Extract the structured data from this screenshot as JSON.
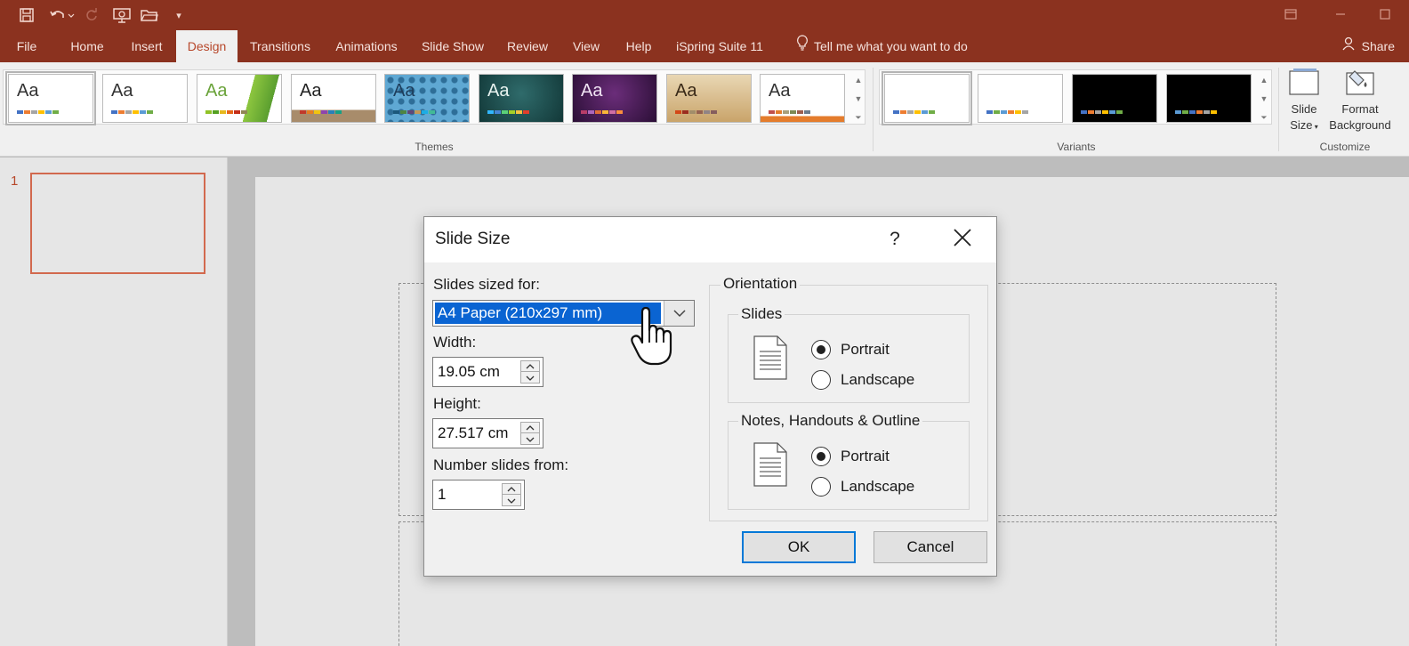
{
  "ribbon_tabs": [
    "File",
    "Home",
    "Insert",
    "Design",
    "Transitions",
    "Animations",
    "Slide Show",
    "Review",
    "View",
    "Help",
    "iSpring Suite 11"
  ],
  "active_tab": "Design",
  "tell_me": "Tell me what you want to do",
  "share": "Share",
  "groups": {
    "themes": "Themes",
    "variants": "Variants",
    "customize": "Customize"
  },
  "theme_thumb_text": "Aa",
  "customize": {
    "slide_size_line1": "Slide",
    "slide_size_line2": "Size",
    "format_bg_line1": "Format",
    "format_bg_line2": "Background"
  },
  "slide_number": "1",
  "dialog": {
    "title": "Slide Size",
    "help": "?",
    "sized_for_label": "Slides sized for:",
    "sized_for_value": "A4 Paper (210x297 mm)",
    "width_label": "Width:",
    "width_value": "19.05 cm",
    "height_label": "Height:",
    "height_value": "27.517 cm",
    "number_from_label": "Number slides from:",
    "number_from_value": "1",
    "orientation_label": "Orientation",
    "slides_group": "Slides",
    "notes_group": "Notes, Handouts & Outline",
    "portrait": "Portrait",
    "landscape": "Landscape",
    "ok": "OK",
    "cancel": "Cancel"
  },
  "colors": {
    "accent": "#8b321f",
    "active_tab_text": "#b7472a",
    "selection": "#0a64d2"
  }
}
